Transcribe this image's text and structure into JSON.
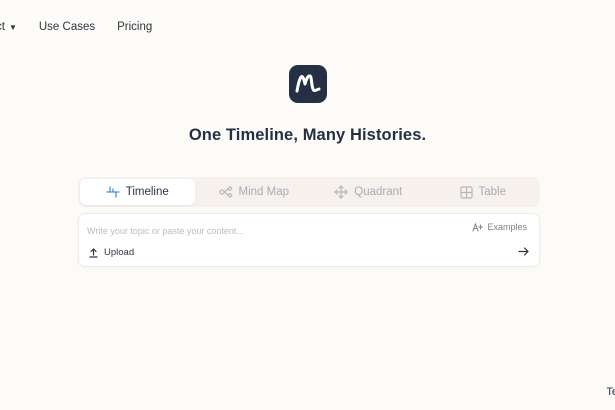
{
  "nav": {
    "items": [
      {
        "label": "ct",
        "has_caret": true
      },
      {
        "label": "Use Cases"
      },
      {
        "label": "Pricing"
      }
    ]
  },
  "hero": {
    "logo_icon": "scribble-m-logo-icon",
    "headline": "One Timeline, Many Histories."
  },
  "tabs": [
    {
      "label": "Timeline",
      "icon": "timeline-icon",
      "active": true
    },
    {
      "label": "Mind Map",
      "icon": "mind-map-icon",
      "active": false
    },
    {
      "label": "Quadrant",
      "icon": "quadrant-icon",
      "active": false
    },
    {
      "label": "Table",
      "icon": "table-icon",
      "active": false
    }
  ],
  "input": {
    "placeholder": "Write your topic or paste your content...",
    "examples_label": "Examples",
    "upload_label": "Upload"
  },
  "corner_text": "Te",
  "colors": {
    "background": "#fdfbf8",
    "logo_bg": "#253044",
    "accent_blue": "#4a90d9"
  }
}
